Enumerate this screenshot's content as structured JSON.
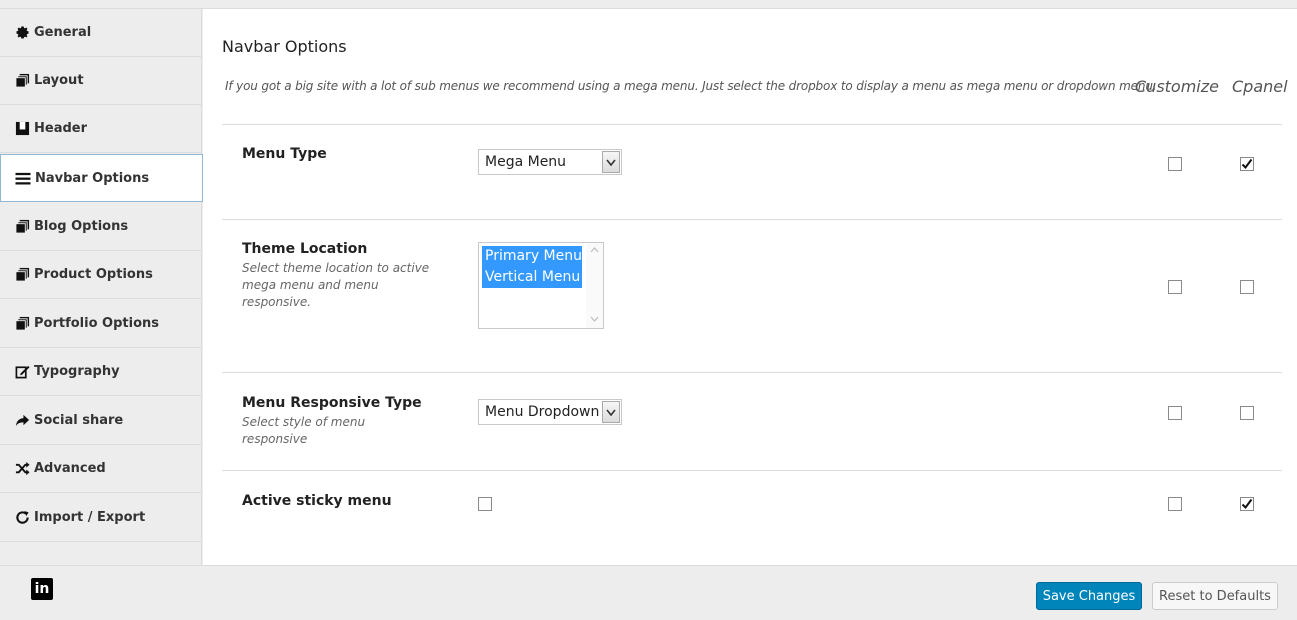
{
  "sidebar": {
    "items": [
      {
        "label": "General",
        "icon": "gear-icon"
      },
      {
        "label": "Layout",
        "icon": "copy-icon"
      },
      {
        "label": "Header",
        "icon": "header-icon"
      },
      {
        "label": "Navbar Options",
        "icon": "bars-icon"
      },
      {
        "label": "Blog Options",
        "icon": "copy-icon"
      },
      {
        "label": "Product Options",
        "icon": "copy-icon"
      },
      {
        "label": "Portfolio Options",
        "icon": "copy-icon"
      },
      {
        "label": "Typography",
        "icon": "edit-icon"
      },
      {
        "label": "Social share",
        "icon": "share-icon"
      },
      {
        "label": "Advanced",
        "icon": "random-icon"
      },
      {
        "label": "Import / Export",
        "icon": "refresh-icon"
      }
    ],
    "active": "Navbar Options"
  },
  "main": {
    "title": "Navbar Options",
    "description": "If you got a big site with a lot of sub menus we recommend using a mega menu. Just select the dropbox to display a menu as mega menu or dropdown menu.",
    "col_customize": "Customize",
    "col_cpanel": "Cpanel",
    "rows": [
      {
        "title": "Menu Type",
        "subtitle": "",
        "control": "select",
        "value": "Mega Menu",
        "customize": false,
        "cpanel": true
      },
      {
        "title": "Theme Location",
        "subtitle": "Select theme location to active mega menu and menu responsive.",
        "control": "multiselect",
        "options": [
          "Primary Menu",
          "Vertical Menu"
        ],
        "customize": false,
        "cpanel": false
      },
      {
        "title": "Menu Responsive Type",
        "subtitle": "Select style of menu responsive",
        "control": "select",
        "value": "Menu Dropdown",
        "customize": false,
        "cpanel": false
      },
      {
        "title": "Active sticky menu",
        "subtitle": "",
        "control": "checkbox",
        "checked": false,
        "customize": false,
        "cpanel": true
      }
    ]
  },
  "footer": {
    "save_label": "Save Changes",
    "reset_label": "Reset to Defaults",
    "social_icon": "linkedin-icon",
    "social_text": "in"
  },
  "colors": {
    "accent": "#0085ba",
    "selection": "#3399ff",
    "background": "#ededed"
  }
}
